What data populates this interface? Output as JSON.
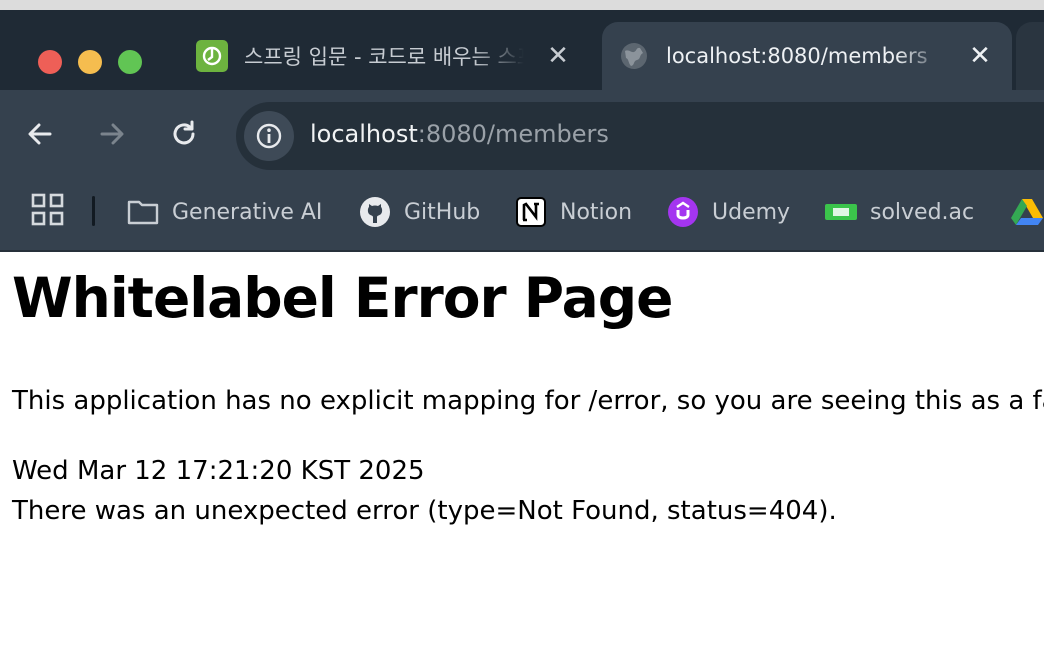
{
  "browser": {
    "tabs": [
      {
        "title": "스프링 입문 - 코드로 배우는 스프링 부트",
        "favicon": "spring-leaf-icon",
        "active": false
      },
      {
        "title": "localhost:8080/members",
        "favicon": "globe-icon",
        "active": true
      }
    ],
    "close_glyph": "✕",
    "address_bar": {
      "host": "localhost",
      "rest": ":8080/members"
    },
    "bookmarks": [
      {
        "label": "Generative AI",
        "icon": "folder-icon"
      },
      {
        "label": "GitHub",
        "icon": "github-icon"
      },
      {
        "label": "Notion",
        "icon": "notion-icon"
      },
      {
        "label": "Udemy",
        "icon": "udemy-icon"
      },
      {
        "label": "solved.ac",
        "icon": "solvedac-icon"
      }
    ]
  },
  "page": {
    "title": "Whitelabel Error Page",
    "message": "This application has no explicit mapping for /error, so you are seeing this as a fallback.",
    "timestamp": "Wed Mar 12 17:21:20 KST 2025",
    "error": "There was an unexpected error (type=Not Found, status=404)."
  }
}
